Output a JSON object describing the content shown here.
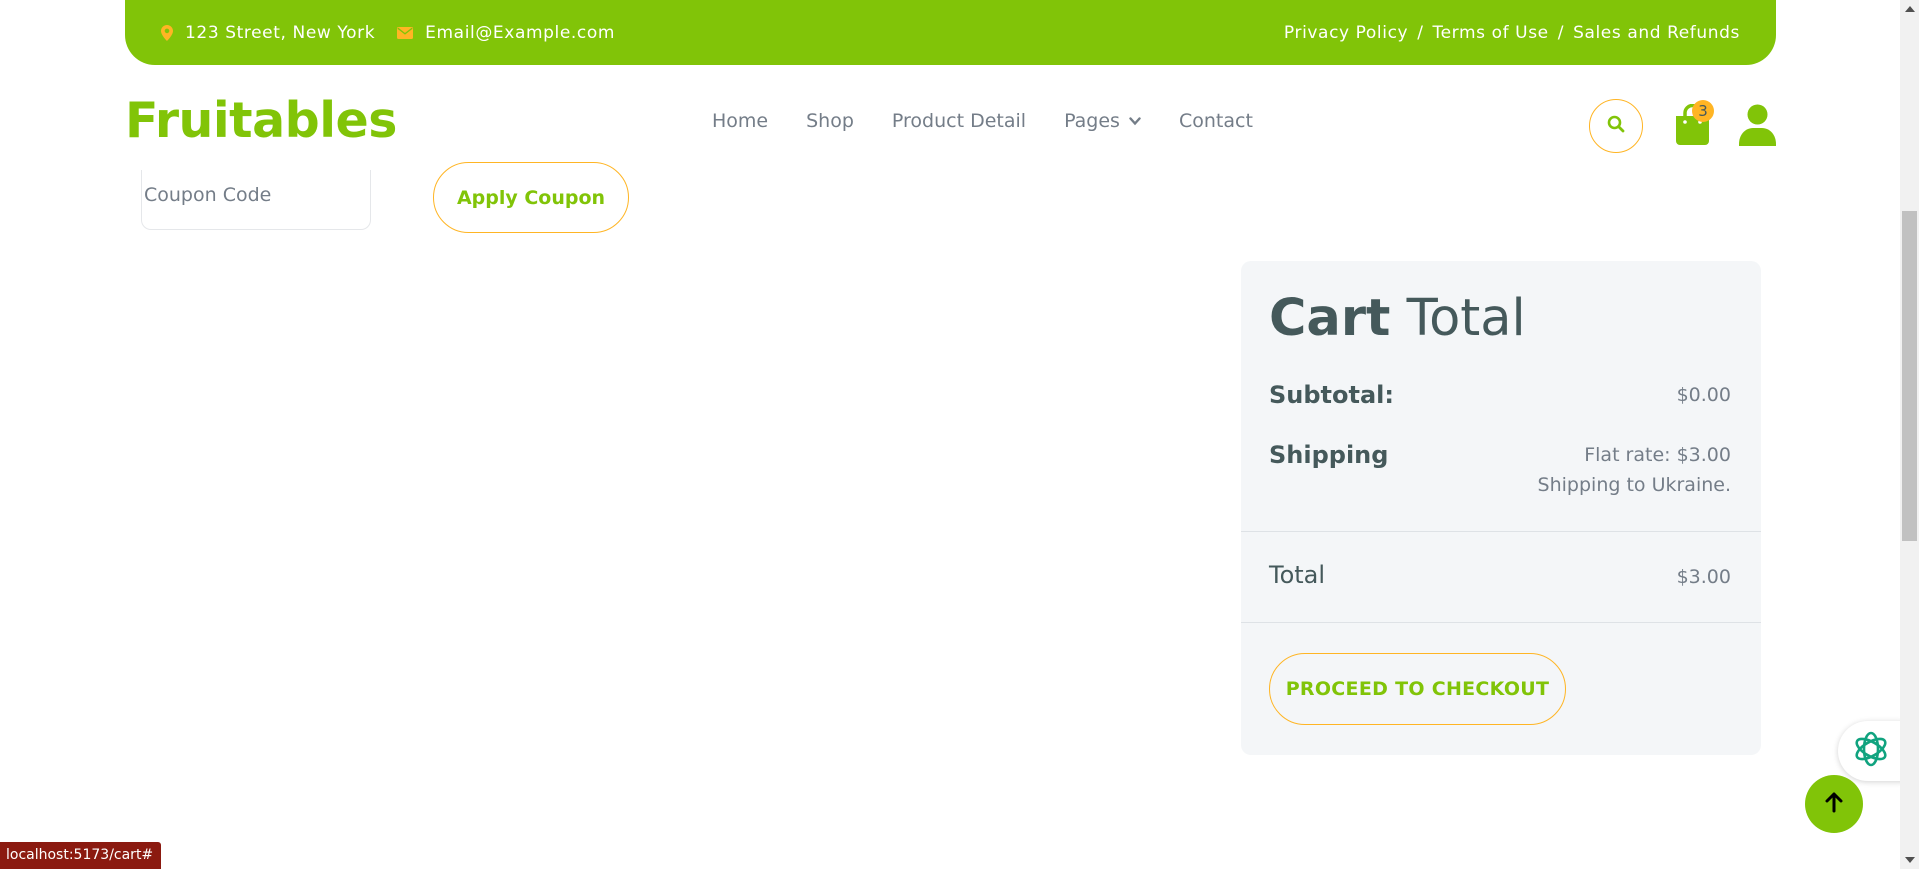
{
  "topbar": {
    "address": "123 Street, New York",
    "email": "Email@Example.com",
    "links": [
      "Privacy Policy",
      "Terms of Use",
      "Sales and Refunds"
    ],
    "separator": "/"
  },
  "navbar": {
    "brand": "Fruitables",
    "items": [
      "Home",
      "Shop",
      "Product Detail",
      "Pages",
      "Contact"
    ],
    "cart_count": "3"
  },
  "coupon": {
    "placeholder": "Coupon Code",
    "apply_label": "Apply Coupon"
  },
  "cart_total": {
    "title_bold": "Cart",
    "title_light": "Total",
    "subtotal_label": "Subtotal:",
    "subtotal_value": "$0.00",
    "shipping_label": "Shipping",
    "shipping_rate": "Flat rate: $3.00",
    "shipping_destination": "Shipping to Ukraine.",
    "total_label": "Total",
    "total_value": "$3.00",
    "checkout_label": "PROCEED TO CHECKOUT"
  },
  "status_bar": {
    "url": "localhost:5173/cart#"
  },
  "colors": {
    "brand": "#81c408",
    "accent": "#ffb524",
    "text": "#45595b",
    "muted": "#747d88"
  }
}
